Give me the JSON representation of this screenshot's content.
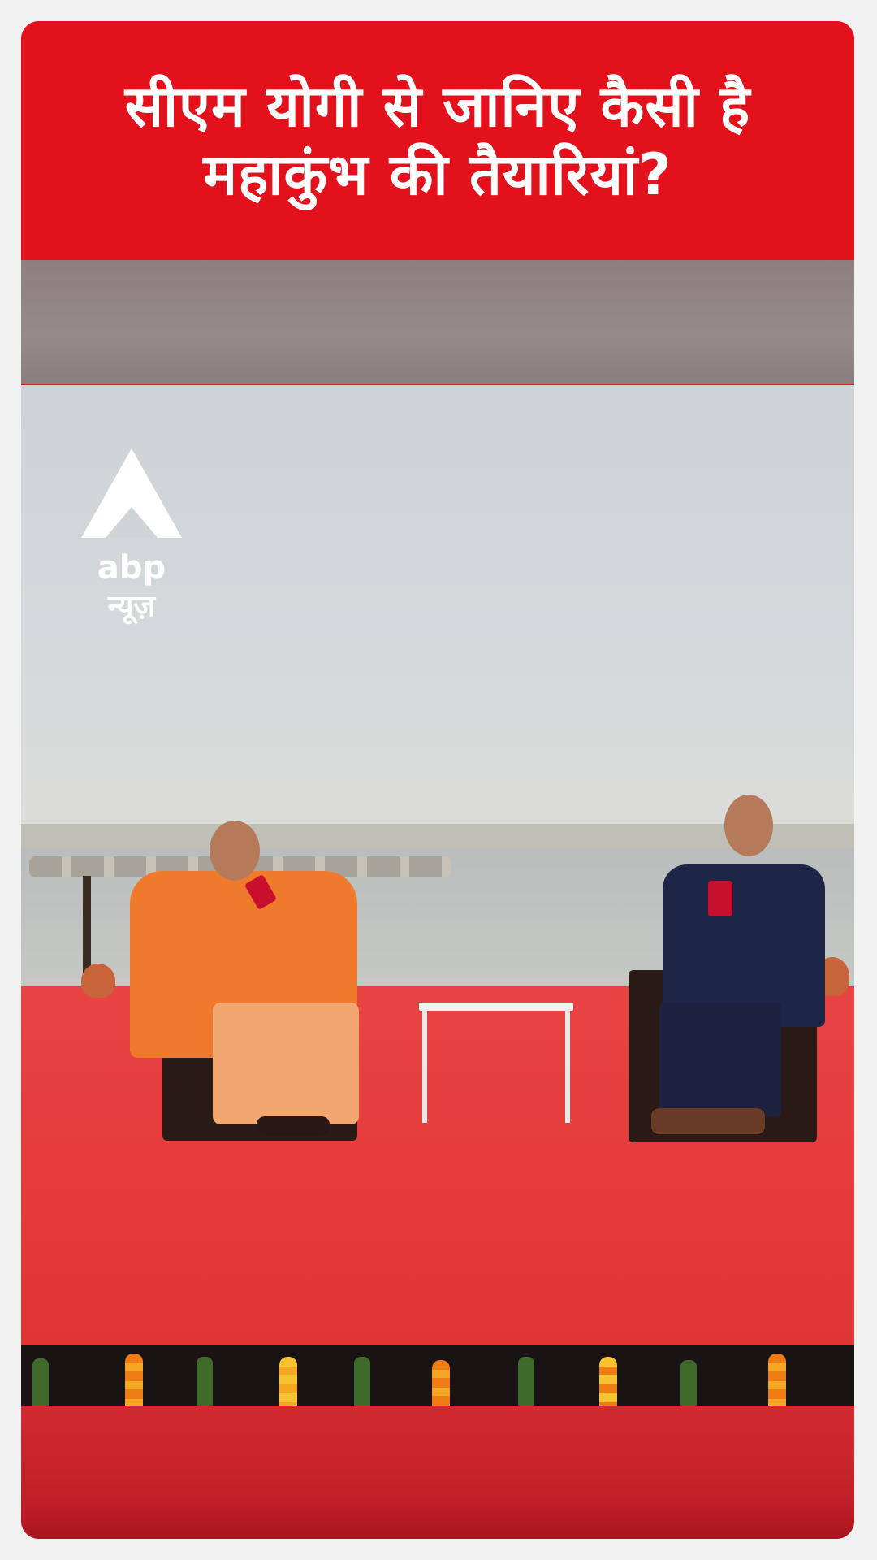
{
  "headline": {
    "line1": "सीएम योगी से जानिए कैसी है",
    "line2": "महाकुंभ की तैयारियां?"
  },
  "logo": {
    "brand": "abp",
    "brand_hindi": "न्यूज़"
  },
  "colors": {
    "headline_bg": "#e3111b",
    "stage_carpet": "#e53a3a",
    "saffron_robe": "#f07a2c",
    "suit_navy": "#1e2648"
  }
}
